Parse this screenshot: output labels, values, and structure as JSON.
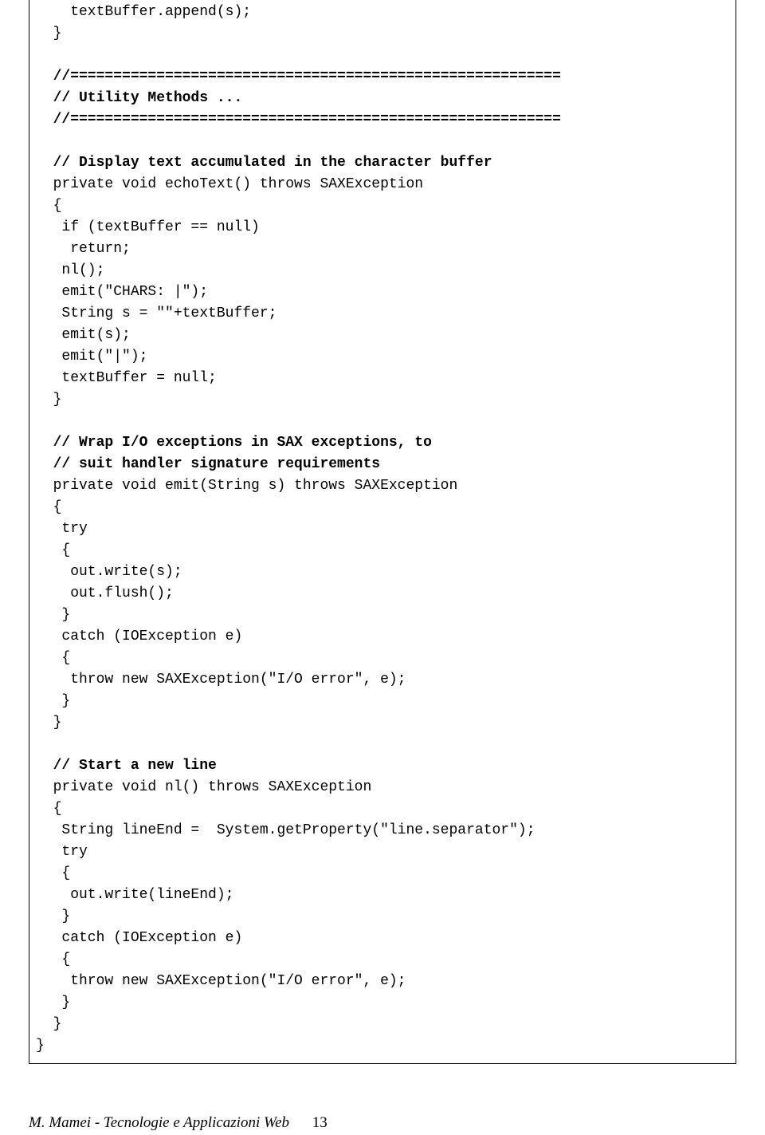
{
  "code": {
    "lines": [
      {
        "text": "    textBuffer.append(s);",
        "bold": false
      },
      {
        "text": "  }",
        "bold": false
      },
      {
        "text": "",
        "bold": false
      },
      {
        "text": "  //=========================================================",
        "bold": true
      },
      {
        "text": "  // Utility Methods ...",
        "bold": true
      },
      {
        "text": "  //=========================================================",
        "bold": true
      },
      {
        "text": "",
        "bold": false
      },
      {
        "text": "  // Display text accumulated in the character buffer",
        "bold": true
      },
      {
        "text": "  private void echoText() throws SAXException",
        "bold": false
      },
      {
        "text": "  {",
        "bold": false
      },
      {
        "text": "   if (textBuffer == null)",
        "bold": false
      },
      {
        "text": "    return;",
        "bold": false
      },
      {
        "text": "   nl();",
        "bold": false
      },
      {
        "text": "   emit(\"CHARS: |\");",
        "bold": false
      },
      {
        "text": "   String s = \"\"+textBuffer;",
        "bold": false
      },
      {
        "text": "   emit(s);",
        "bold": false
      },
      {
        "text": "   emit(\"|\");",
        "bold": false
      },
      {
        "text": "   textBuffer = null;",
        "bold": false
      },
      {
        "text": "  }",
        "bold": false
      },
      {
        "text": "",
        "bold": false
      },
      {
        "text": "  // Wrap I/O exceptions in SAX exceptions, to",
        "bold": true
      },
      {
        "text": "  // suit handler signature requirements",
        "bold": true
      },
      {
        "text": "  private void emit(String s) throws SAXException",
        "bold": false
      },
      {
        "text": "  {",
        "bold": false
      },
      {
        "text": "   try",
        "bold": false
      },
      {
        "text": "   {",
        "bold": false
      },
      {
        "text": "    out.write(s);",
        "bold": false
      },
      {
        "text": "    out.flush();",
        "bold": false
      },
      {
        "text": "   }",
        "bold": false
      },
      {
        "text": "   catch (IOException e)",
        "bold": false
      },
      {
        "text": "   {",
        "bold": false
      },
      {
        "text": "    throw new SAXException(\"I/O error\", e);",
        "bold": false
      },
      {
        "text": "   }",
        "bold": false
      },
      {
        "text": "  }",
        "bold": false
      },
      {
        "text": "",
        "bold": false
      },
      {
        "text": "  // Start a new line",
        "bold": true
      },
      {
        "text": "  private void nl() throws SAXException",
        "bold": false
      },
      {
        "text": "  {",
        "bold": false
      },
      {
        "text": "   String lineEnd =  System.getProperty(\"line.separator\");",
        "bold": false
      },
      {
        "text": "   try",
        "bold": false
      },
      {
        "text": "   {",
        "bold": false
      },
      {
        "text": "    out.write(lineEnd);",
        "bold": false
      },
      {
        "text": "   }",
        "bold": false
      },
      {
        "text": "   catch (IOException e)",
        "bold": false
      },
      {
        "text": "   {",
        "bold": false
      },
      {
        "text": "    throw new SAXException(\"I/O error\", e);",
        "bold": false
      },
      {
        "text": "   }",
        "bold": false
      },
      {
        "text": "  }",
        "bold": false
      },
      {
        "text": "}",
        "bold": false
      }
    ]
  },
  "footer": {
    "text": "M. Mamei - Tecnologie e Applicazioni Web",
    "page": "13"
  }
}
